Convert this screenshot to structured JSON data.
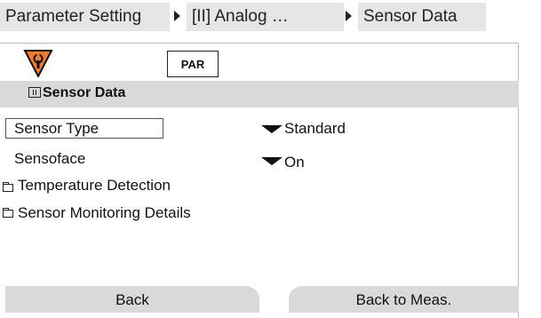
{
  "breadcrumb": {
    "items": [
      {
        "label": "Parameter Setting"
      },
      {
        "label": "[II] Analog …"
      },
      {
        "label": "Sensor Data"
      }
    ]
  },
  "toolbar": {
    "warning_icon": "wrench-warning-icon",
    "mode_label": "PAR"
  },
  "menu": {
    "title": "Sensor Data",
    "title_icon": "channel-ii-icon",
    "items": [
      {
        "label": "Sensor Type",
        "value": "Standard",
        "type": "dropdown",
        "selected": true
      },
      {
        "label": "Sensoface",
        "value": "On",
        "type": "dropdown",
        "selected": false
      },
      {
        "label": "Temperature Detection",
        "type": "folder"
      },
      {
        "label": "Sensor Monitoring Details",
        "type": "folder"
      }
    ]
  },
  "softkeys": {
    "left_label": "Back",
    "right_label": "Back to Meas."
  },
  "colors": {
    "warning_fill": "#f07a2a",
    "bar_gray": "#d9d9d9",
    "crumb_gray": "#e6e6e6"
  }
}
